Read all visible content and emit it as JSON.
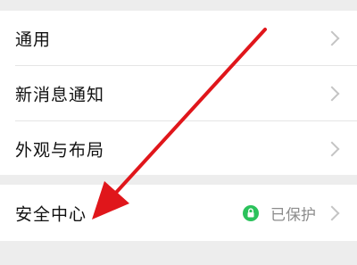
{
  "settings": {
    "items": [
      {
        "label": "通用"
      },
      {
        "label": "新消息通知"
      },
      {
        "label": "外观与布局"
      }
    ],
    "security": {
      "label": "安全中心",
      "status": "已保护",
      "status_icon": "shield-check-icon",
      "status_color": "#2bc25b"
    }
  },
  "annotation": {
    "arrow_color": "#e0161b"
  }
}
